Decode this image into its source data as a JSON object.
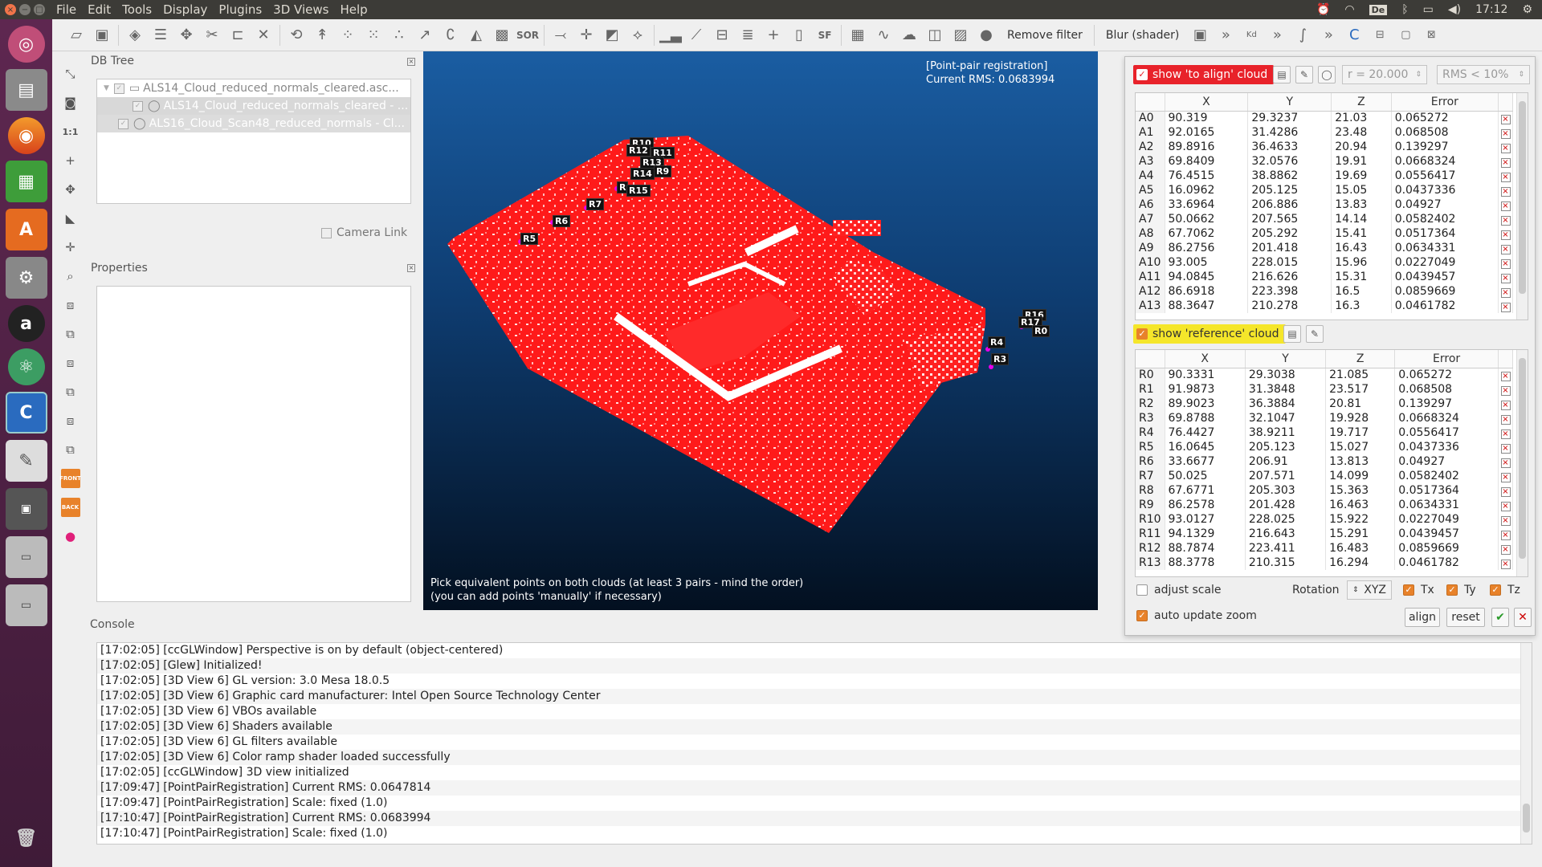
{
  "menubar": {
    "items": [
      "File",
      "Edit",
      "Tools",
      "Display",
      "Plugins",
      "3D Views",
      "Help"
    ],
    "clock": "17:12",
    "lang": "De"
  },
  "toolbar": {
    "remove_filter": "Remove filter",
    "blur_shader": "Blur (shader)",
    "sf_label": "SF",
    "sor_label": "SOR",
    "kd_label": "Kd"
  },
  "vstrip": {
    "scale_label": "1:1",
    "front": "FRONT",
    "back": "BACK"
  },
  "dbtree": {
    "title": "DB Tree",
    "items": [
      "ALS14_Cloud_reduced_normals_cleared.asc...",
      "ALS14_Cloud_reduced_normals_cleared - ...",
      "ALS16_Cloud_Scan48_reduced_normals - Cl..."
    ],
    "camera_link": "Camera Link"
  },
  "properties": {
    "title": "Properties"
  },
  "view3d": {
    "info_title": "[Point-pair registration]",
    "info_rms": "Current RMS: 0.0683994",
    "hint1": "Pick equivalent points on both clouds (at least 3 pairs - mind the order)",
    "hint2": "(you can add points 'manually' if necessary)",
    "labels": [
      "R10",
      "R12",
      "R11",
      "R13",
      "R9",
      "R14",
      "R",
      "R15",
      "R7",
      "R6",
      "R5",
      "R16",
      "R17",
      "R0",
      "R4",
      "R3"
    ]
  },
  "registration": {
    "show_align": "show 'to align' cloud",
    "show_ref": "show 'reference' cloud",
    "radius": "r = 20.000",
    "rms_filter": "RMS < 10%",
    "headers": [
      "X",
      "Y",
      "Z",
      "Error"
    ],
    "align_rows": [
      [
        "A0",
        "90.319",
        "29.3237",
        "21.03",
        "0.065272"
      ],
      [
        "A1",
        "92.0165",
        "31.4286",
        "23.48",
        "0.068508"
      ],
      [
        "A2",
        "89.8916",
        "36.4633",
        "20.94",
        "0.139297"
      ],
      [
        "A3",
        "69.8409",
        "32.0576",
        "19.91",
        "0.0668324"
      ],
      [
        "A4",
        "76.4515",
        "38.8862",
        "19.69",
        "0.0556417"
      ],
      [
        "A5",
        "16.0962",
        "205.125",
        "15.05",
        "0.0437336"
      ],
      [
        "A6",
        "33.6964",
        "206.886",
        "13.83",
        "0.04927"
      ],
      [
        "A7",
        "50.0662",
        "207.565",
        "14.14",
        "0.0582402"
      ],
      [
        "A8",
        "67.7062",
        "205.292",
        "15.41",
        "0.0517364"
      ],
      [
        "A9",
        "86.2756",
        "201.418",
        "16.43",
        "0.0634331"
      ],
      [
        "A10",
        "93.005",
        "228.015",
        "15.96",
        "0.0227049"
      ],
      [
        "A11",
        "94.0845",
        "216.626",
        "15.31",
        "0.0439457"
      ],
      [
        "A12",
        "86.6918",
        "223.398",
        "16.5",
        "0.0859669"
      ],
      [
        "A13",
        "88.3647",
        "210.278",
        "16.3",
        "0.0461782"
      ]
    ],
    "ref_rows": [
      [
        "R0",
        "90.3331",
        "29.3038",
        "21.085",
        "0.065272"
      ],
      [
        "R1",
        "91.9873",
        "31.3848",
        "23.517",
        "0.068508"
      ],
      [
        "R2",
        "89.9023",
        "36.3884",
        "20.81",
        "0.139297"
      ],
      [
        "R3",
        "69.8788",
        "32.1047",
        "19.928",
        "0.0668324"
      ],
      [
        "R4",
        "76.4427",
        "38.9211",
        "19.717",
        "0.0556417"
      ],
      [
        "R5",
        "16.0645",
        "205.123",
        "15.027",
        "0.0437336"
      ],
      [
        "R6",
        "33.6677",
        "206.91",
        "13.813",
        "0.04927"
      ],
      [
        "R7",
        "50.025",
        "207.571",
        "14.099",
        "0.0582402"
      ],
      [
        "R8",
        "67.6771",
        "205.303",
        "15.363",
        "0.0517364"
      ],
      [
        "R9",
        "86.2578",
        "201.428",
        "16.463",
        "0.0634331"
      ],
      [
        "R10",
        "93.0127",
        "228.025",
        "15.922",
        "0.0227049"
      ],
      [
        "R11",
        "94.1329",
        "216.643",
        "15.291",
        "0.0439457"
      ],
      [
        "R12",
        "88.7874",
        "223.411",
        "16.483",
        "0.0859669"
      ],
      [
        "R13",
        "88.3778",
        "210.315",
        "16.294",
        "0.0461782"
      ]
    ],
    "adjust_scale": "adjust scale",
    "rotation_label": "Rotation",
    "rotation_value": "XYZ",
    "tx": "Tx",
    "ty": "Ty",
    "tz": "Tz",
    "auto_zoom": "auto update zoom",
    "align_btn": "align",
    "reset_btn": "reset"
  },
  "console": {
    "title": "Console",
    "lines": [
      "[17:02:05] [ccGLWindow] Perspective is on by default (object-centered)",
      "[17:02:05] [Glew] Initialized!",
      "[17:02:05] [3D View 6] GL version: 3.0 Mesa 18.0.5",
      "[17:02:05] [3D View 6] Graphic card manufacturer: Intel Open Source Technology Center",
      "[17:02:05] [3D View 6] VBOs available",
      "[17:02:05] [3D View 6] Shaders available",
      "[17:02:05] [3D View 6] GL filters available",
      "[17:02:05] [3D View 6] Color ramp shader loaded successfully",
      "[17:02:05] [ccGLWindow] 3D view initialized",
      "[17:09:47] [PointPairRegistration] Current RMS: 0.0647814",
      "[17:09:47] [PointPairRegistration] Scale: fixed (1.0)",
      "[17:10:47] [PointPairRegistration] Current RMS: 0.0683994",
      "[17:10:47] [PointPairRegistration] Scale: fixed (1.0)"
    ]
  },
  "colors": {
    "accent": "#e8822a",
    "highlight": "#f5e62a",
    "cloud_red": "#ff1a1a"
  }
}
